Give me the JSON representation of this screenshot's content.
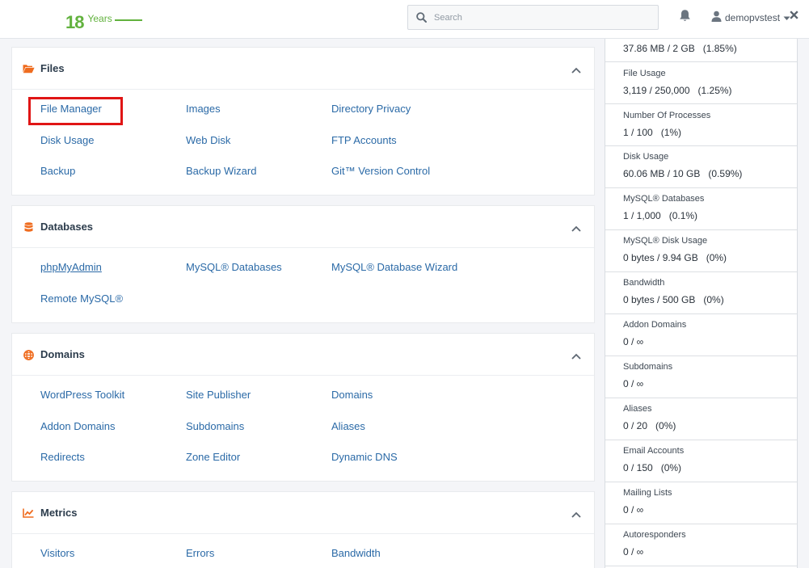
{
  "header": {
    "logo_number": "18",
    "logo_word": "Years",
    "search_placeholder": "Search",
    "username": "demopvstest"
  },
  "colors": {
    "link": "#2b6aa7",
    "accent_orange": "#ef6c1f",
    "logo_green": "#62b23e",
    "highlight_red": "#e01515"
  },
  "sections": {
    "files": {
      "title": "Files",
      "icon": "folder-open-icon",
      "items": [
        "File Manager",
        "Images",
        "Directory Privacy",
        "Disk Usage",
        "Web Disk",
        "FTP Accounts",
        "Backup",
        "Backup Wizard",
        "Git™ Version Control"
      ]
    },
    "databases": {
      "title": "Databases",
      "icon": "database-icon",
      "items": [
        "phpMyAdmin",
        "MySQL® Databases",
        "MySQL® Database Wizard",
        "Remote MySQL®"
      ]
    },
    "domains": {
      "title": "Domains",
      "icon": "globe-icon",
      "items": [
        "WordPress Toolkit",
        "Site Publisher",
        "Domains",
        "Addon Domains",
        "Subdomains",
        "Aliases",
        "Redirects",
        "Zone Editor",
        "Dynamic DNS"
      ]
    },
    "metrics": {
      "title": "Metrics",
      "icon": "chart-line-icon",
      "items": [
        "Visitors",
        "Errors",
        "Bandwidth"
      ]
    }
  },
  "stats": {
    "top_value": "37.86 MB / 2 GB   (1.85%)",
    "rows": [
      {
        "label": "File Usage",
        "value": "3,119 / 250,000   (1.25%)"
      },
      {
        "label": "Number Of Processes",
        "value": "1 / 100   (1%)"
      },
      {
        "label": "Disk Usage",
        "value": "60.06 MB / 10 GB   (0.59%)"
      },
      {
        "label": "MySQL® Databases",
        "value": "1 / 1,000   (0.1%)"
      },
      {
        "label": "MySQL® Disk Usage",
        "value": "0 bytes / 9.94 GB   (0%)"
      },
      {
        "label": "Bandwidth",
        "value": "0 bytes / 500 GB   (0%)"
      },
      {
        "label": "Addon Domains",
        "value": "0 / ∞"
      },
      {
        "label": "Subdomains",
        "value": "0 / ∞"
      },
      {
        "label": "Aliases",
        "value": "0 / 20   (0%)"
      },
      {
        "label": "Email Accounts",
        "value": "0 / 150   (0%)"
      },
      {
        "label": "Mailing Lists",
        "value": "0 / ∞"
      },
      {
        "label": "Autoresponders",
        "value": "0 / ∞"
      }
    ]
  }
}
